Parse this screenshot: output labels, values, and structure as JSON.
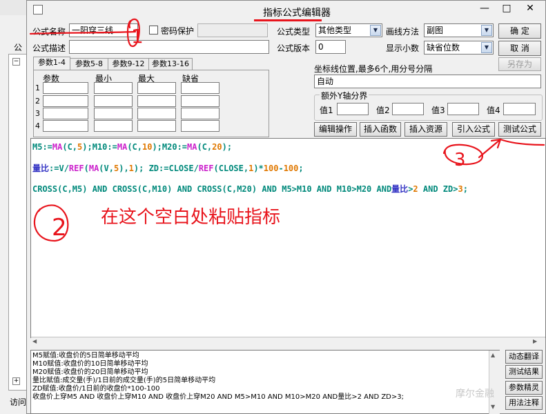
{
  "background": {
    "left_label": "公",
    "bottom_label": "访问"
  },
  "window": {
    "title": "指标公式编辑器",
    "min_label": "—",
    "max_label": "□",
    "close_label": "✕"
  },
  "form": {
    "name_label": "公式名称",
    "name_value": "一阳穿三线",
    "password_label": "密码保护",
    "desc_label": "公式描述",
    "desc_value": "",
    "type_label": "公式类型",
    "type_value": "其他类型",
    "version_label": "公式版本",
    "version_value": "0",
    "draw_label": "画线方法",
    "draw_value": "副图",
    "decimals_label": "显示小数",
    "decimals_value": "缺省位数"
  },
  "buttons": {
    "ok": "确  定",
    "cancel": "取  消",
    "save_as": "另存为",
    "edit_ops": "编辑操作",
    "insert_func": "插入函数",
    "insert_res": "插入资源",
    "import_formula": "引入公式",
    "test_formula": "测试公式",
    "dynamic_translate": "动态翻译",
    "test_result": "测试结果",
    "param_wizard": "参数精灵",
    "usage_notes": "用法注释"
  },
  "param_tabs": [
    "参数1-4",
    "参数5-8",
    "参数9-12",
    "参数13-16"
  ],
  "param_headers": [
    "参数",
    "最小",
    "最大",
    "缺省"
  ],
  "param_rows": [
    "1",
    "2",
    "3",
    "4"
  ],
  "coord": {
    "label": "坐标线位置,最多6个,用分号分隔",
    "value": "自动"
  },
  "yaxis": {
    "legend": "额外Y轴分界",
    "labels": [
      "值1",
      "值2",
      "值3",
      "值4"
    ]
  },
  "editor": {
    "line1": [
      {
        "t": "M5:=",
        "c": "green"
      },
      {
        "t": "MA",
        "c": "mag"
      },
      {
        "t": "(C,",
        "c": "green"
      },
      {
        "t": "5",
        "c": "org"
      },
      {
        "t": ");M10:=",
        "c": "green"
      },
      {
        "t": "MA",
        "c": "mag"
      },
      {
        "t": "(C,",
        "c": "green"
      },
      {
        "t": "10",
        "c": "org"
      },
      {
        "t": ");M20:=",
        "c": "green"
      },
      {
        "t": "MA",
        "c": "mag"
      },
      {
        "t": "(C,",
        "c": "green"
      },
      {
        "t": "20",
        "c": "org"
      },
      {
        "t": ");",
        "c": "green"
      }
    ],
    "line2": [
      {
        "t": "量比",
        "c": "blue"
      },
      {
        "t": ":=V/",
        "c": "green"
      },
      {
        "t": "REF",
        "c": "mag"
      },
      {
        "t": "(",
        "c": "green"
      },
      {
        "t": "MA",
        "c": "mag"
      },
      {
        "t": "(V,",
        "c": "green"
      },
      {
        "t": "5",
        "c": "org"
      },
      {
        "t": "),",
        "c": "green"
      },
      {
        "t": "1",
        "c": "org"
      },
      {
        "t": "); ZD:=CLOSE/",
        "c": "green"
      },
      {
        "t": "REF",
        "c": "mag"
      },
      {
        "t": "(CLOSE,",
        "c": "green"
      },
      {
        "t": "1",
        "c": "org"
      },
      {
        "t": ")*",
        "c": "green"
      },
      {
        "t": "100",
        "c": "org"
      },
      {
        "t": "-",
        "c": "green"
      },
      {
        "t": "100",
        "c": "org"
      },
      {
        "t": ";",
        "c": "green"
      }
    ],
    "line3": [
      {
        "t": "CROSS(C,M5) AND CROSS(C,M10) AND CROSS(C,M20) AND M5>M10 AND M10>M20 AND",
        "c": "green"
      },
      {
        "t": "量比",
        "c": "blue"
      },
      {
        "t": ">",
        "c": "green"
      },
      {
        "t": "2",
        "c": "org"
      },
      {
        "t": " AND ZD>",
        "c": "green"
      },
      {
        "t": "3",
        "c": "org"
      },
      {
        "t": ";",
        "c": "green"
      }
    ],
    "annotation_text": "在这个空白处粘贴指标",
    "mark_1": "1",
    "mark_2": "2",
    "mark_3": "3"
  },
  "help_lines": [
    "M5赋值:收盘价的5日简单移动平均",
    "M10赋值:收盘价的10日简单移动平均",
    "M20赋值:收盘价的20日简单移动平均",
    "量比赋值:成交量(手)/1日前的成交量(手)的5日简单移动平均",
    "ZD赋值:收盘价/1日前的收盘价*100-100",
    "收盘价上穿M5 AND 收盘价上穿M10 AND 收盘价上穿M20 AND M5>M10 AND M10>M20 AND量比>2 AND ZD>3;"
  ],
  "watermark": "摩尔金融",
  "colors": {
    "annotation_red": "#e8141c",
    "code_green": "#00897b",
    "code_blue": "#3434c4",
    "code_magenta": "#cc22cc",
    "code_orange": "#e07800"
  }
}
